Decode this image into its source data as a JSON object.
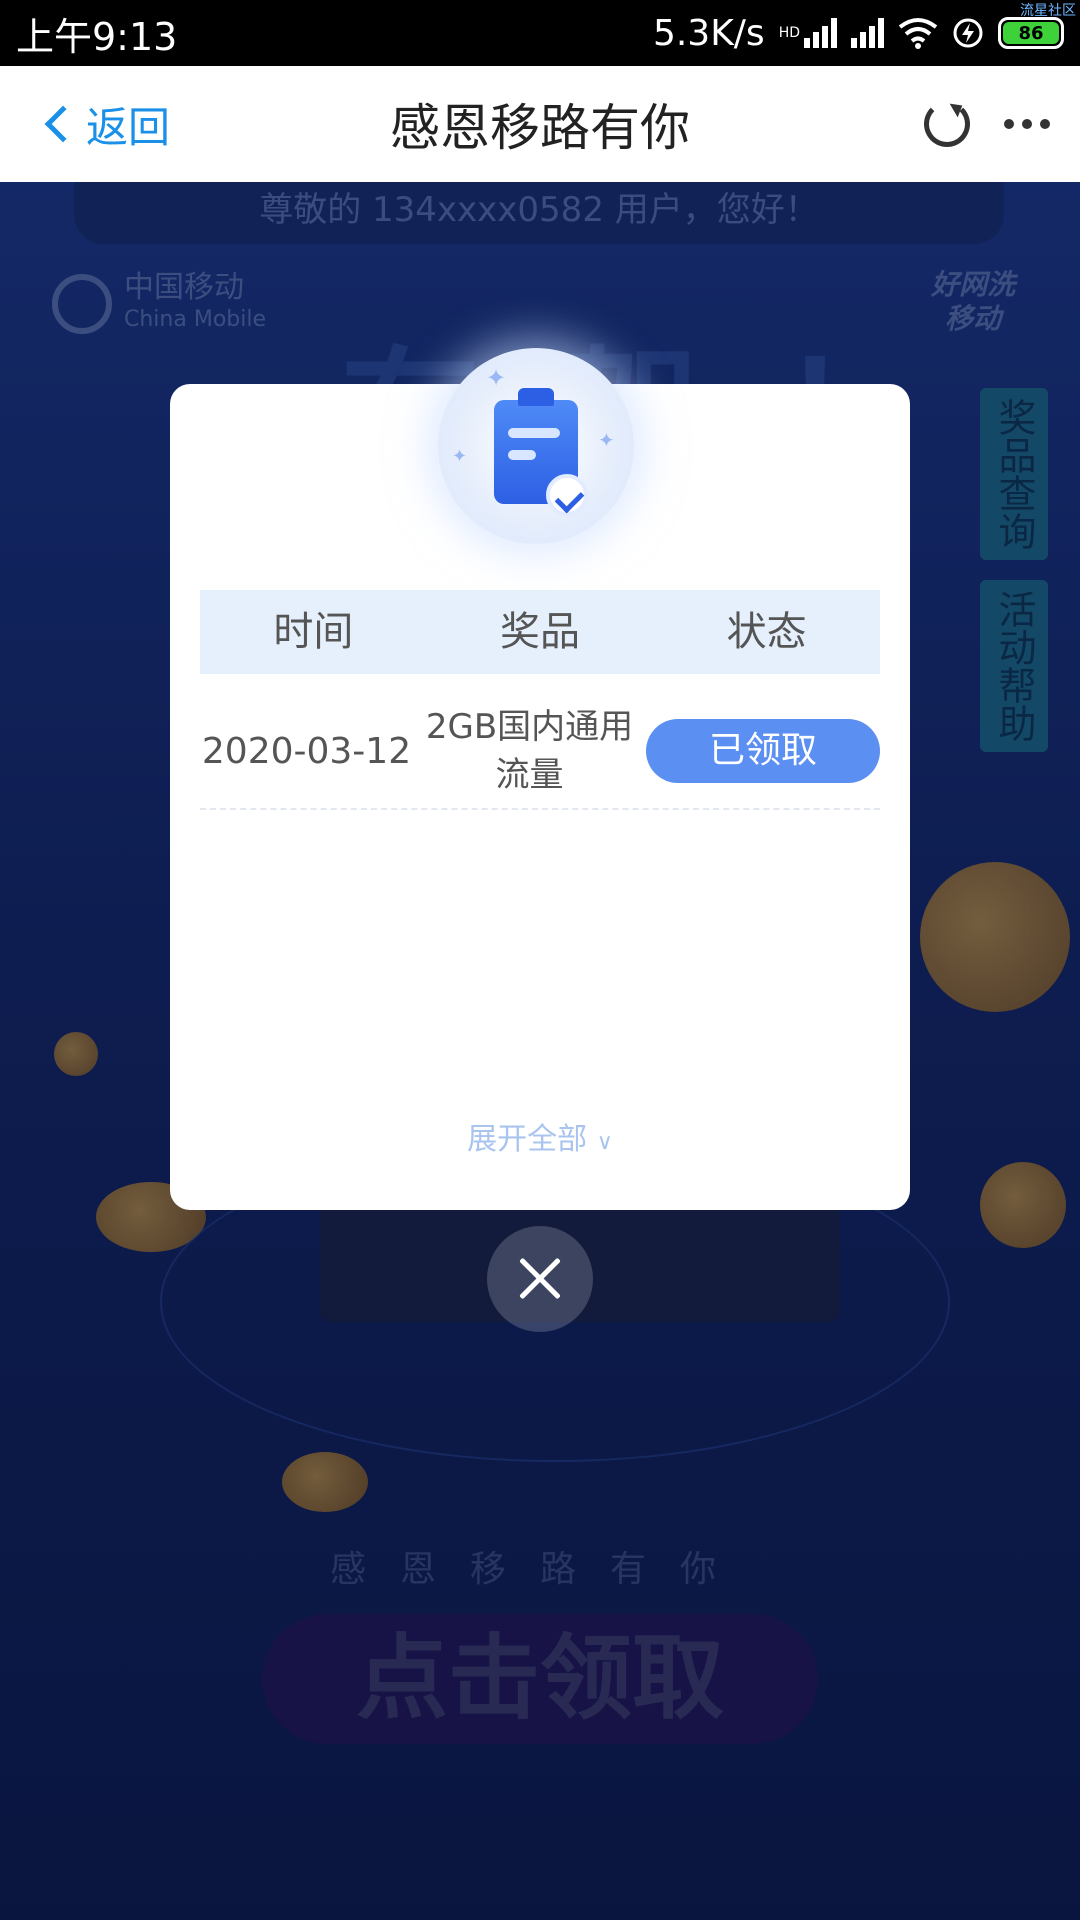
{
  "status_bar": {
    "time": "上午9:13",
    "net_speed": "5.3K/s",
    "hd_label": "HD",
    "battery": "86",
    "corner_tag": "流星社区"
  },
  "header": {
    "back_label": "返回",
    "title": "感恩移路有你"
  },
  "background": {
    "greeting": "尊敬的 134xxxx0582 用户，您好！",
    "logo_cn": "中国移动",
    "logo_en": "China Mobile",
    "badge": "好网洗移动",
    "big_text": "有贺！",
    "side_tabs": [
      "奖品查询",
      "活动帮助"
    ],
    "caption": "感恩移路有你",
    "claim_button": "点击领取"
  },
  "modal": {
    "headers": [
      "时间",
      "奖品",
      "状态"
    ],
    "rows": [
      {
        "date": "2020-03-12",
        "prize": "2GB国内通用流量",
        "status": "已领取"
      }
    ],
    "expand_label": "展开全部",
    "expand_chevron": "∨"
  },
  "colors": {
    "accent": "#5b8ff2",
    "link": "#1b90e8",
    "table_header_bg": "#e6f0fd",
    "page_bg": "#14286b"
  },
  "icons": [
    "back-chevron-icon",
    "refresh-icon",
    "more-icon",
    "clipboard-check-icon",
    "close-icon"
  ]
}
